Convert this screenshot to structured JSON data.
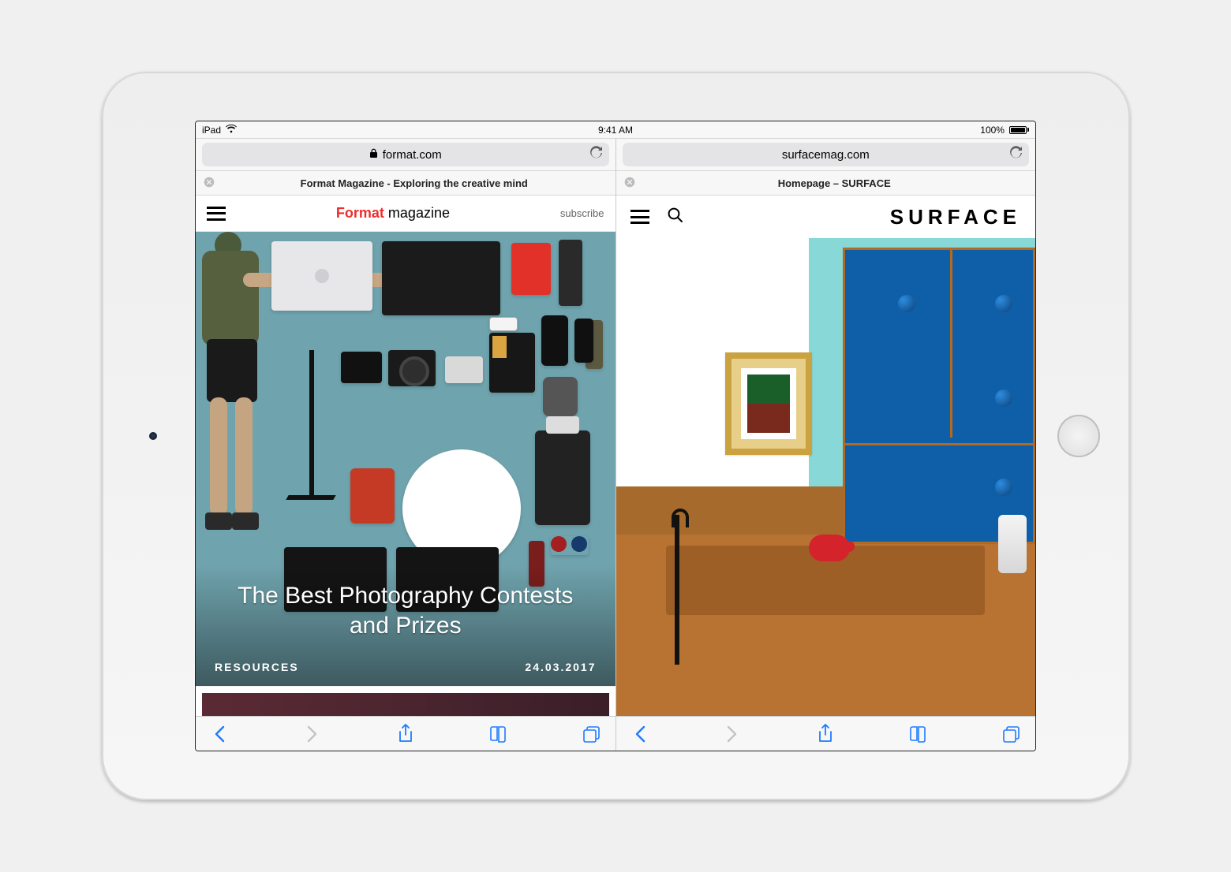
{
  "status_bar": {
    "device": "iPad",
    "time": "9:41 AM",
    "battery_pct": "100%"
  },
  "panes": [
    {
      "url": "format.com",
      "secure": true,
      "tab_title": "Format Magazine - Exploring the creative mind",
      "site": {
        "brand_word": "Format",
        "title_rest": "magazine",
        "subscribe_label": "subscribe",
        "hero_headline": "The Best Photography Contests and Prizes",
        "category": "RESOURCES",
        "date": "24.03.2017"
      }
    },
    {
      "url": "surfacemag.com",
      "secure": false,
      "tab_title": "Homepage – SURFACE",
      "site": {
        "logo_text": "SURFACE"
      }
    }
  ]
}
